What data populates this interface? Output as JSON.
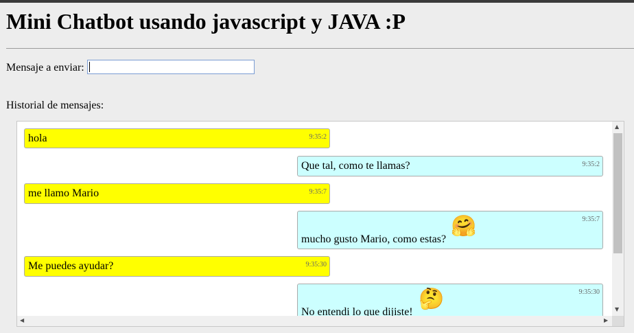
{
  "page": {
    "title": "Mini Chatbot usando javascript y JAVA :P",
    "message_label": "Mensaje a enviar:",
    "message_value": "",
    "history_label": "Historial de mensajes:"
  },
  "messages": [
    {
      "from": "user",
      "text": "hola",
      "time": "9:35:2"
    },
    {
      "from": "bot",
      "text": "Que tal, como te llamas?",
      "time": "9:35:2"
    },
    {
      "from": "user",
      "text": "me llamo Mario",
      "time": "9:35:7"
    },
    {
      "from": "bot",
      "text": "mucho gusto Mario, como estas?",
      "time": "9:35:7",
      "emoji": "hugging-face-emoji",
      "emoji_char": "🤗"
    },
    {
      "from": "user",
      "text": "Me puedes ayudar?",
      "time": "9:35:30"
    },
    {
      "from": "bot",
      "text": "No entendi lo que dijiste!",
      "time": "9:35:30",
      "emoji": "thinking-face-emoji",
      "emoji_char": "🤔"
    }
  ],
  "colors": {
    "user_bubble": "#ffff00",
    "bot_bubble": "#ccffff",
    "page_background": "#ededed"
  },
  "icons": {
    "scroll_up": "▲",
    "scroll_down": "▼",
    "scroll_left": "◀",
    "scroll_right": "▶"
  }
}
